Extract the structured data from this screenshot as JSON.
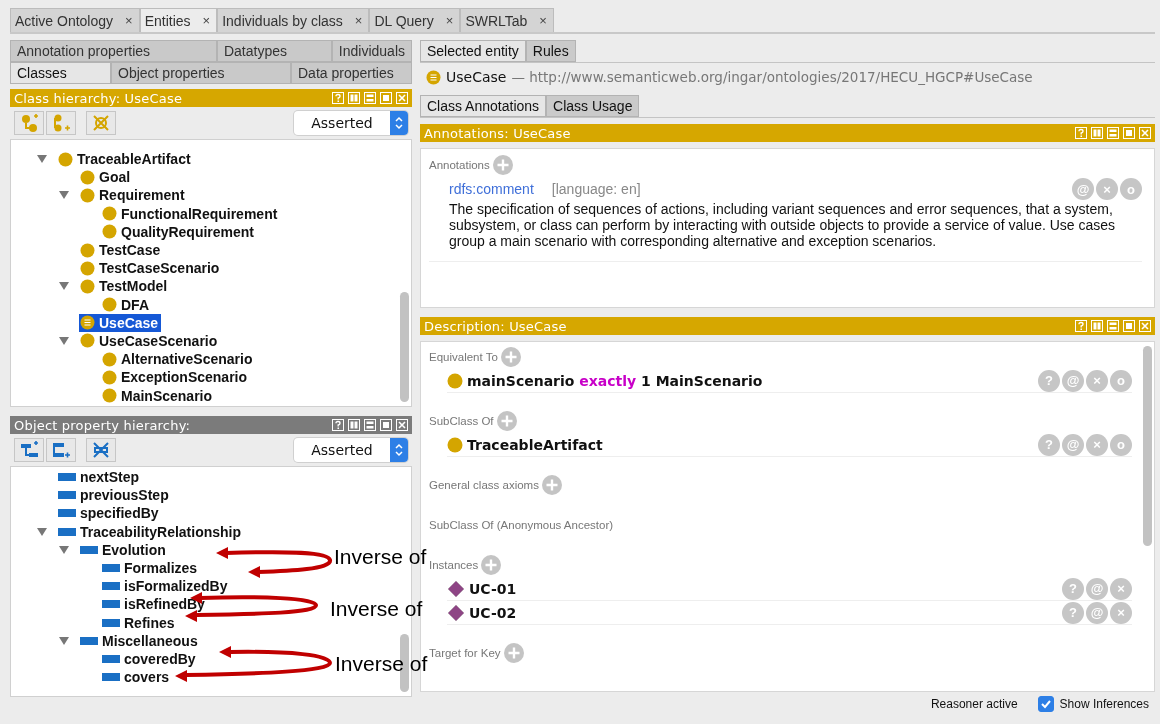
{
  "tabs": [
    {
      "label": "Active Ontology",
      "close": "×",
      "selected": false
    },
    {
      "label": "Entities",
      "close": "×",
      "selected": true
    },
    {
      "label": "Individuals by class",
      "close": "×",
      "selected": false
    },
    {
      "label": "DL Query",
      "close": "×",
      "selected": false
    },
    {
      "label": "SWRLTab",
      "close": "×",
      "selected": false
    }
  ],
  "entity_tabs": [
    [
      {
        "label": "Annotation properties",
        "selected": false
      },
      {
        "label": "Datatypes",
        "selected": false
      },
      {
        "label": "Individuals",
        "selected": false
      }
    ],
    [
      {
        "label": "Classes",
        "selected": true
      },
      {
        "label": "Object properties",
        "selected": false
      },
      {
        "label": "Data properties",
        "selected": false
      }
    ]
  ],
  "class_hierarchy": {
    "title": "Class hierarchy: UseCase",
    "active": true,
    "mode": "Asserted",
    "tree": [
      {
        "label": "TraceableArtifact",
        "selected": false,
        "expanded": true,
        "children": [
          {
            "label": "Goal",
            "selected": false
          },
          {
            "label": "Requirement",
            "selected": false,
            "expanded": true,
            "children": [
              {
                "label": "FunctionalRequirement",
                "selected": false
              },
              {
                "label": "QualityRequirement",
                "selected": false
              }
            ]
          },
          {
            "label": "TestCase",
            "selected": false
          },
          {
            "label": "TestCaseScenario",
            "selected": false
          },
          {
            "label": "TestModel",
            "selected": false,
            "expanded": true,
            "children": [
              {
                "label": "DFA",
                "selected": false
              }
            ]
          },
          {
            "label": "UseCase",
            "selected": true
          },
          {
            "label": "UseCaseScenario",
            "selected": false,
            "expanded": true,
            "children": [
              {
                "label": "AlternativeScenario",
                "selected": false
              },
              {
                "label": "ExceptionScenario",
                "selected": false
              },
              {
                "label": "MainScenario",
                "selected": false
              }
            ]
          }
        ]
      }
    ]
  },
  "object_property_hierarchy": {
    "title": "Object property hierarchy:",
    "active": false,
    "mode": "Asserted",
    "tree": [
      {
        "label": "nextStep"
      },
      {
        "label": "previousStep"
      },
      {
        "label": "specifiedBy"
      },
      {
        "label": "TraceabilityRelationship",
        "expanded": true,
        "children": [
          {
            "label": "Evolution",
            "expanded": true,
            "children": [
              {
                "label": "Formalizes"
              },
              {
                "label": "isFormalizedBy"
              },
              {
                "label": "isRefinedBy"
              },
              {
                "label": "Refines"
              }
            ]
          },
          {
            "label": "Miscellaneous",
            "expanded": true,
            "children": [
              {
                "label": "coveredBy"
              },
              {
                "label": "covers"
              }
            ]
          }
        ]
      }
    ]
  },
  "right_tabs": [
    {
      "label": "Selected entity",
      "selected": true
    },
    {
      "label": "Rules",
      "selected": false
    }
  ],
  "entity": {
    "name": "UseCase",
    "iri": "— http://www.semanticweb.org/ingar/ontologies/2017/HECU_HGCP#UseCase"
  },
  "view_tabs": [
    {
      "label": "Class Annotations",
      "selected": true
    },
    {
      "label": "Class Usage",
      "selected": false
    }
  ],
  "annotations_panel": {
    "title": "Annotations: UseCase",
    "active": true,
    "section": "Annotations",
    "items": [
      {
        "property": "rdfs:comment",
        "language": "[language: en]",
        "text": "The specification of sequences of actions, including variant sequences and error sequences, that a system, subsystem, or class can perform by interacting with outside objects to provide a service of value. Use cases group a main scenario with corresponding alternative and exception scenarios.",
        "actions": [
          "@",
          "×",
          "o"
        ]
      }
    ]
  },
  "description_panel": {
    "title": "Description: UseCase",
    "active": true,
    "sections": [
      {
        "label": "Equivalent To",
        "addable": true,
        "items": [
          {
            "kind": "class",
            "parts": [
              {
                "text": "mainScenario",
                "kind": "name"
              },
              {
                "text": "exactly",
                "kind": "keyword"
              },
              {
                "text": "1 MainScenario",
                "kind": "name"
              }
            ],
            "actions": [
              "?",
              "@",
              "×",
              "o"
            ]
          }
        ]
      },
      {
        "label": "SubClass Of",
        "addable": true,
        "items": [
          {
            "kind": "class",
            "parts": [
              {
                "text": "TraceableArtifact",
                "kind": "name"
              }
            ],
            "actions": [
              "?",
              "@",
              "×",
              "o"
            ]
          }
        ]
      },
      {
        "label": "General class axioms",
        "addable": true
      },
      {
        "label": "SubClass Of (Anonymous Ancestor)",
        "addable": false
      },
      {
        "label": "Instances",
        "addable": true,
        "items": [
          {
            "kind": "individual",
            "parts": [
              {
                "text": "UC-01",
                "kind": "name"
              }
            ],
            "actions": [
              "?",
              "@",
              "×"
            ]
          },
          {
            "kind": "individual",
            "parts": [
              {
                "text": "UC-02",
                "kind": "name"
              }
            ],
            "actions": [
              "?",
              "@",
              "×"
            ]
          }
        ]
      },
      {
        "label": "Target for Key",
        "addable": true
      }
    ]
  },
  "status_bar": {
    "reasoner": "Reasoner active",
    "show_inferences": {
      "label": "Show Inferences",
      "checked": true
    }
  },
  "callouts": [
    {
      "label": "Inverse of"
    },
    {
      "label": "Inverse of"
    },
    {
      "label": "Inverse of"
    }
  ]
}
